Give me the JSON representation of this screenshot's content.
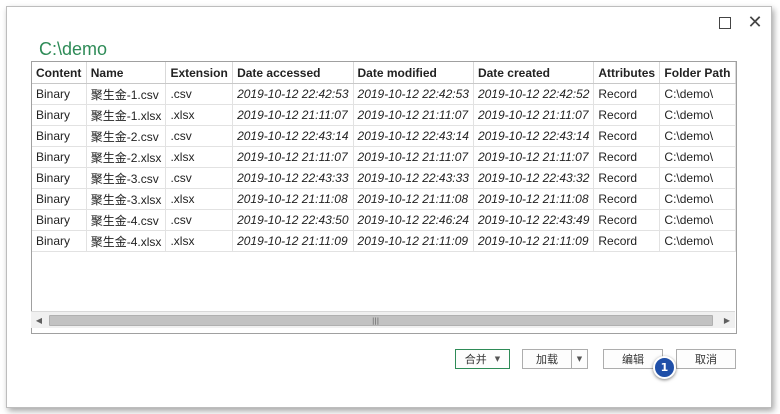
{
  "window": {
    "title": "C:\\demo",
    "maximize_icon": "maximize-icon",
    "close_icon": "close-icon",
    "close_glyph": "✕"
  },
  "table": {
    "columns": [
      "Content",
      "Name",
      "Extension",
      "Date accessed",
      "Date modified",
      "Date created",
      "Attributes",
      "Folder Path"
    ],
    "rows": [
      [
        "Binary",
        "聚生金-1.csv",
        ".csv",
        "2019-10-12 22:42:53",
        "2019-10-12 22:42:53",
        "2019-10-12 22:42:52",
        "Record",
        "C:\\demo\\"
      ],
      [
        "Binary",
        "聚生金-1.xlsx",
        ".xlsx",
        "2019-10-12 21:11:07",
        "2019-10-12 21:11:07",
        "2019-10-12 21:11:07",
        "Record",
        "C:\\demo\\"
      ],
      [
        "Binary",
        "聚生金-2.csv",
        ".csv",
        "2019-10-12 22:43:14",
        "2019-10-12 22:43:14",
        "2019-10-12 22:43:14",
        "Record",
        "C:\\demo\\"
      ],
      [
        "Binary",
        "聚生金-2.xlsx",
        ".xlsx",
        "2019-10-12 21:11:07",
        "2019-10-12 21:11:07",
        "2019-10-12 21:11:07",
        "Record",
        "C:\\demo\\"
      ],
      [
        "Binary",
        "聚生金-3.csv",
        ".csv",
        "2019-10-12 22:43:33",
        "2019-10-12 22:43:33",
        "2019-10-12 22:43:32",
        "Record",
        "C:\\demo\\"
      ],
      [
        "Binary",
        "聚生金-3.xlsx",
        ".xlsx",
        "2019-10-12 21:11:08",
        "2019-10-12 21:11:08",
        "2019-10-12 21:11:08",
        "Record",
        "C:\\demo\\"
      ],
      [
        "Binary",
        "聚生金-4.csv",
        ".csv",
        "2019-10-12 22:43:50",
        "2019-10-12 22:46:24",
        "2019-10-12 22:43:49",
        "Record",
        "C:\\demo\\"
      ],
      [
        "Binary",
        "聚生金-4.xlsx",
        ".xlsx",
        "2019-10-12 21:11:09",
        "2019-10-12 21:11:09",
        "2019-10-12 21:11:09",
        "Record",
        "C:\\demo\\"
      ]
    ]
  },
  "scrollbar": {
    "left_glyph": "◀",
    "right_glyph": "▶",
    "grip_glyph": "|||"
  },
  "buttons": {
    "combine": "合并",
    "dropdown_glyph": "▼",
    "load": "加载",
    "edit": "编辑",
    "cancel": "取消"
  },
  "badge": {
    "label": "1"
  },
  "colors": {
    "accent": "#2e8b57",
    "badge": "#1f4fa8"
  }
}
